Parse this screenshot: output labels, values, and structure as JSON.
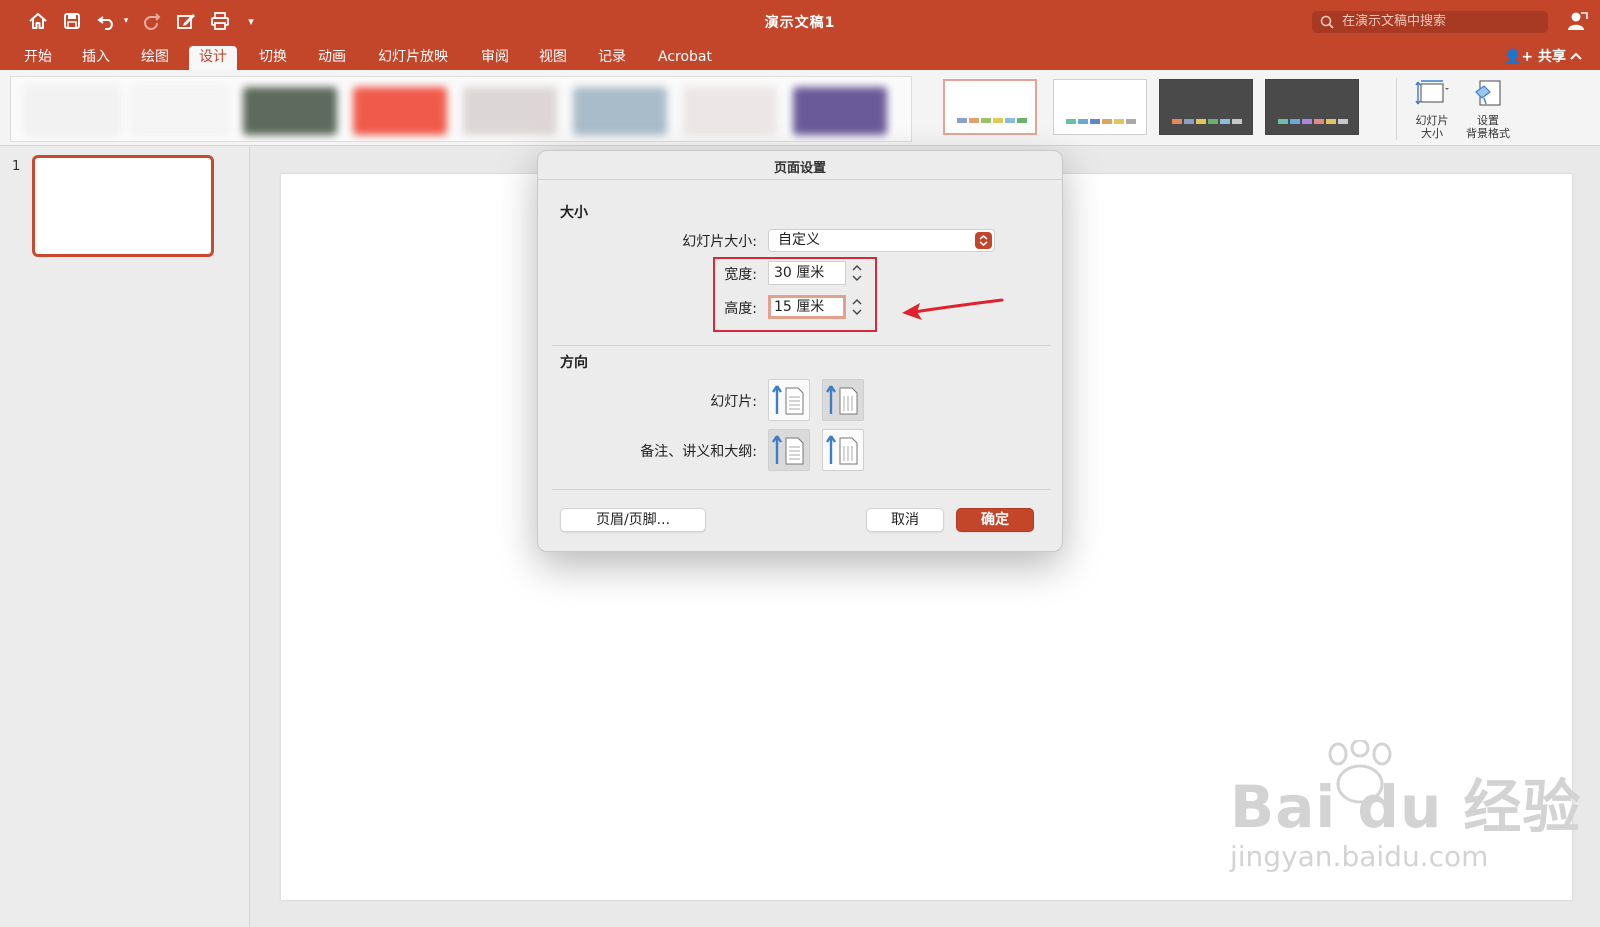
{
  "window": {
    "title": "演示文稿1",
    "search_placeholder": "在演示文稿中搜索",
    "share_label": "共享"
  },
  "ribbon_tabs": [
    "开始",
    "插入",
    "绘图",
    "设计",
    "切换",
    "动画",
    "幻灯片放映",
    "审阅",
    "视图",
    "记录",
    "Acrobat"
  ],
  "active_tab": "设计",
  "ribbon_buttons": {
    "slide_size": "幻灯片\n大小",
    "format_background": "设置\n背景格式"
  },
  "variants": [
    {
      "bg": "#ffffff",
      "selected": true,
      "swatches": [
        "#8aa0c8",
        "#e0a26a",
        "#9ac26a",
        "#e2c65a",
        "#8bbcd8",
        "#6ab26a"
      ]
    },
    {
      "bg": "#ffffff",
      "selected": false,
      "swatches": [
        "#6abfa8",
        "#6aa8d8",
        "#5a8ac8",
        "#e2a25a",
        "#e2c65a",
        "#a8a8a8"
      ]
    },
    {
      "bg": "#4a4a4a",
      "selected": false,
      "swatches": [
        "#e28a5a",
        "#8aa0c8",
        "#e2c65a",
        "#6ab26a",
        "#8bbcd8",
        "#c8c8c8"
      ]
    },
    {
      "bg": "#4a4a4a",
      "selected": false,
      "swatches": [
        "#6abfa8",
        "#6aa8d8",
        "#a88ad8",
        "#e28a8a",
        "#e2c65a",
        "#c8c8c8"
      ]
    }
  ],
  "slides": [
    {
      "number": "1"
    }
  ],
  "dialog": {
    "title": "页面设置",
    "size_section": "大小",
    "slide_size_label": "幻灯片大小:",
    "slide_size_value": "自定义",
    "width_label": "宽度:",
    "width_value": "30 厘米",
    "height_label": "高度:",
    "height_value": "15 厘米",
    "orientation_section": "方向",
    "slides_label": "幻灯片:",
    "notes_label": "备注、讲义和大纲:",
    "header_footer_button": "页眉/页脚...",
    "cancel_button": "取消",
    "ok_button": "确定"
  },
  "watermark": {
    "main": "Bai du 经验",
    "sub": "jingyan.baidu.com"
  },
  "colors": {
    "accent": "#c3452a",
    "annotation_red": "#d5283b"
  }
}
